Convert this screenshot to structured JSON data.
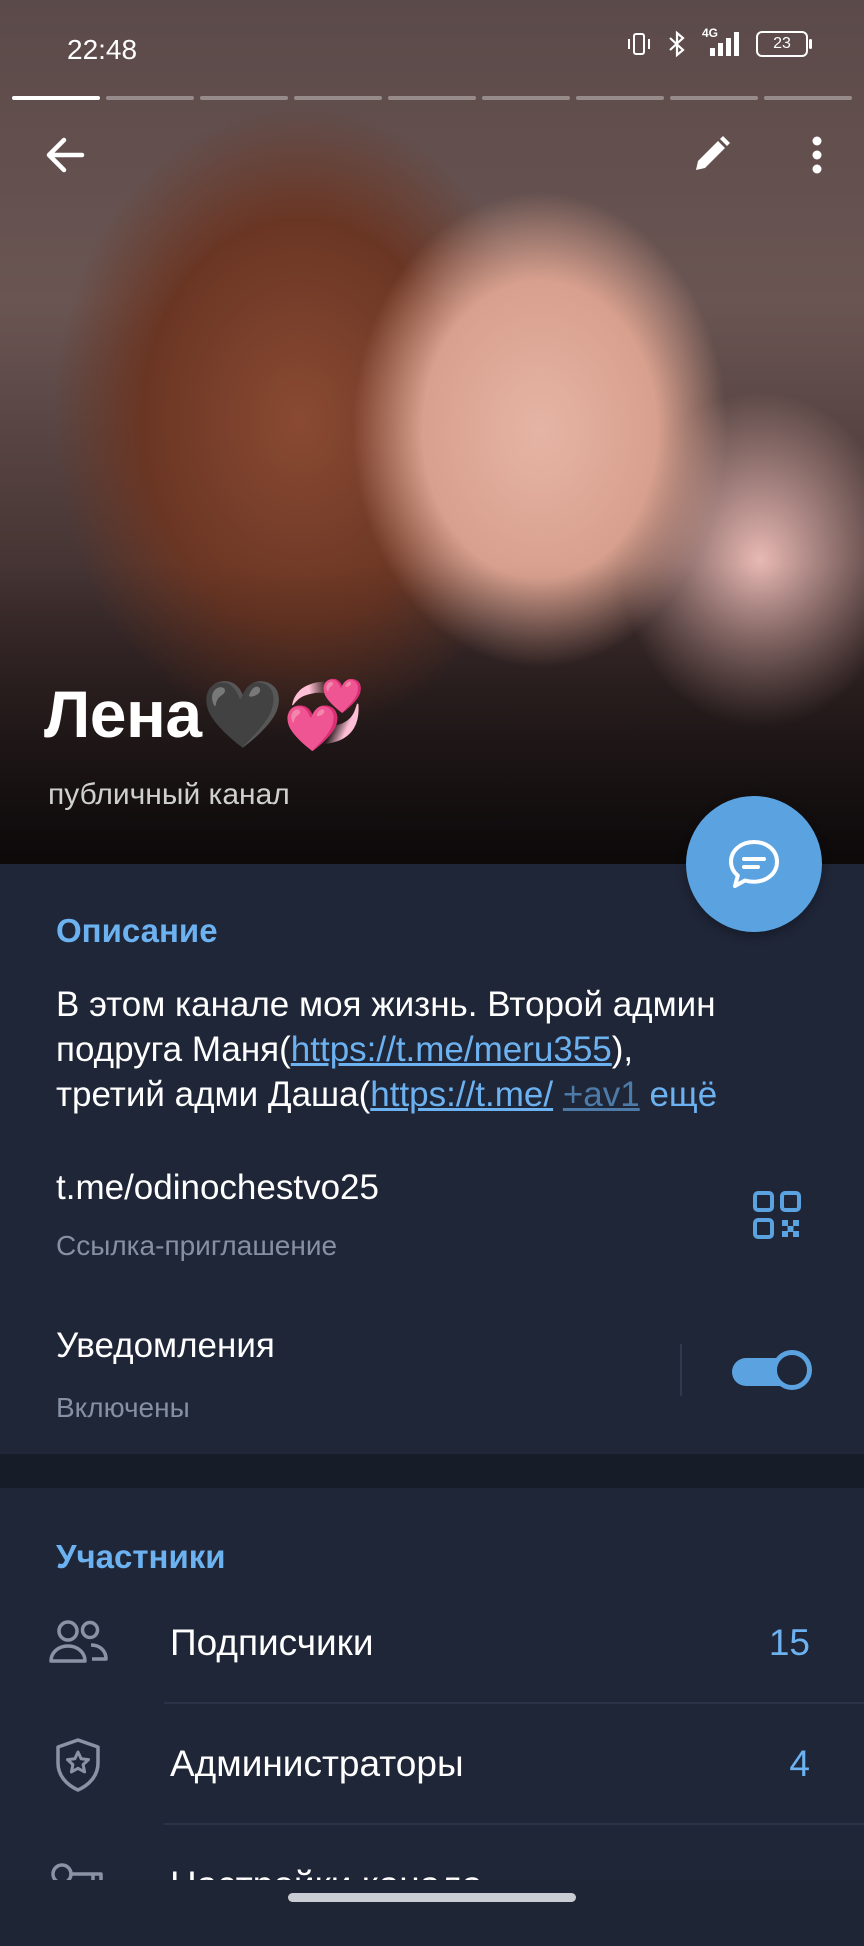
{
  "status_bar": {
    "time": "22:48",
    "battery": "23",
    "network": "4G",
    "icons": [
      "vibrate-icon",
      "bluetooth-icon",
      "signal-icon",
      "battery-icon"
    ]
  },
  "story_progress": {
    "segments": 9,
    "active_index": 0
  },
  "header": {
    "back_icon": "arrow-left-icon",
    "edit_icon": "pencil-icon",
    "more_icon": "vertical-dots-icon"
  },
  "profile": {
    "name": "Лена🖤💞",
    "subtitle": "публичный канал"
  },
  "fab": {
    "icon": "chat-bubble-icon"
  },
  "info": {
    "description_title": "Описание",
    "description": {
      "line1": "В этом канале моя жизнь. Второй админ",
      "line2_prefix": "подруга Маня(",
      "line2_link": "https://t.me/meru355",
      "line2_suffix": "),",
      "line3_prefix": "третий адми Даша(",
      "line3_link": "https://t.me/",
      "line3_link2": "+av1",
      "more": "ещё"
    },
    "link": {
      "value": "t.me/odinochestvo25",
      "label": "Ссылка-приглашение",
      "icon": "qr-code-icon"
    },
    "notifications": {
      "title": "Уведомления",
      "status": "Включены",
      "enabled": true
    }
  },
  "members": {
    "title": "Участники",
    "items": [
      {
        "icon": "users-icon",
        "label": "Подписчики",
        "count": "15"
      },
      {
        "icon": "shield-star-icon",
        "label": "Администраторы",
        "count": "4"
      },
      {
        "icon": "key-icon",
        "label": "Настройки канала",
        "count": ""
      }
    ]
  },
  "colors": {
    "accent": "#5aa2e0",
    "link": "#6db2f0",
    "panel": "#1f2638",
    "background": "#1e2535"
  }
}
